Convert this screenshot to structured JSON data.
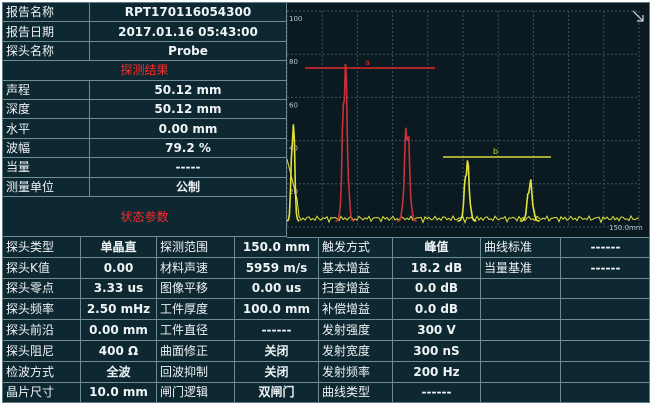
{
  "report": {
    "rows": [
      {
        "label": "报告名称",
        "value": "RPT170116054300"
      },
      {
        "label": "报告日期",
        "value": "2017.01.16  05:43:00"
      },
      {
        "label": "探头名称",
        "value": "Probe"
      }
    ]
  },
  "results": {
    "title": "探测结果",
    "rows": [
      {
        "label": "声程",
        "value": "50.12 mm"
      },
      {
        "label": "深度",
        "value": "50.12 mm"
      },
      {
        "label": "水平",
        "value": "0.00 mm"
      },
      {
        "label": "波幅",
        "value": "79.2 %"
      },
      {
        "label": "当量",
        "value": "-----"
      },
      {
        "label": "测量单位",
        "value": "公制"
      }
    ]
  },
  "status": {
    "title": "状态参数",
    "rows": [
      [
        "探头类型",
        "单晶直",
        "探测范围",
        "150.0 mm",
        "触发方式",
        "峰值",
        "曲线标准",
        "------"
      ],
      [
        "探头K值",
        "0.00",
        "材料声速",
        "5959 m/s",
        "基本增益",
        "18.2 dB",
        "当量基准",
        "------"
      ],
      [
        "探头零点",
        "3.33 us",
        "图像平移",
        "0.00 us",
        "扫查增益",
        "0.0 dB",
        "",
        ""
      ],
      [
        "探头频率",
        "2.50 mHz",
        "工件厚度",
        "100.0 mm",
        "补偿增益",
        "0.0 dB",
        "",
        ""
      ],
      [
        "探头前沿",
        "0.00 mm",
        "工件直径",
        "------",
        "发射强度",
        "300 V",
        "",
        ""
      ],
      [
        "探头阻尼",
        "400 Ω",
        "曲面修正",
        "关闭",
        "发射宽度",
        "300 nS",
        "",
        ""
      ],
      [
        "检波方式",
        "全波",
        "回波抑制",
        "关闭",
        "发射频率",
        "200 Hz",
        "",
        ""
      ],
      [
        "晶片尺寸",
        "10.0 mm",
        "闸门逻辑",
        "双闸门",
        "曲线类型",
        "------",
        "",
        ""
      ]
    ]
  },
  "waveform": {
    "y_ticks": [
      "100",
      "80",
      "60",
      "40",
      "20"
    ],
    "x_end_label": "150.0mm",
    "gate_a_label": "a",
    "gate_b_label": "b",
    "colors": {
      "trace_yellow": "#e2e23a",
      "trace_red": "#c8323a",
      "gate_a": "#e0282a",
      "gate_b": "#d6d63a",
      "grid": "#3c5560"
    }
  }
}
